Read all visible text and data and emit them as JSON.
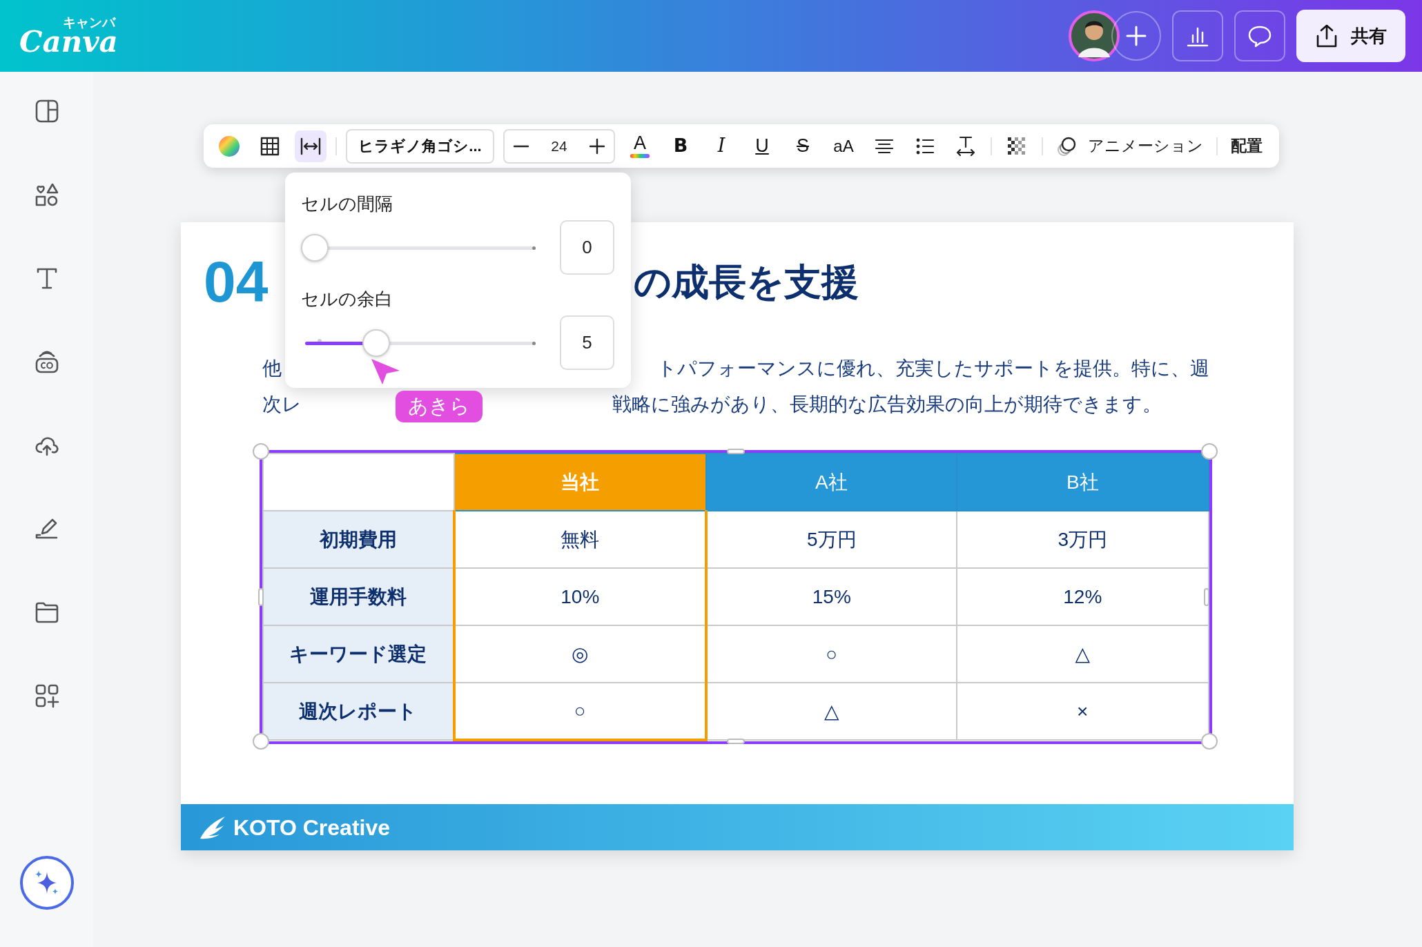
{
  "header": {
    "logo_kana": "キャンバ",
    "logo": "Canva",
    "share_label": "共有"
  },
  "toolbar": {
    "tools": [
      {
        "kind": "color",
        "selected": false
      },
      {
        "kind": "table",
        "selected": false
      },
      {
        "kind": "spacing",
        "selected": true
      }
    ],
    "font": "ヒラギノ角ゴシ...",
    "font_size": "24",
    "format": [
      {
        "kind": "text-color",
        "label": "A"
      },
      {
        "kind": "bold",
        "label": "B"
      },
      {
        "kind": "italic",
        "label": "I"
      },
      {
        "kind": "underline",
        "label": "U"
      },
      {
        "kind": "strike",
        "label": "S"
      },
      {
        "kind": "case",
        "label": "aA"
      }
    ],
    "animation": "アニメーション",
    "arrange": "配置"
  },
  "popup": {
    "sliders": [
      {
        "label": "セルの間隔",
        "level": 0,
        "value": "0"
      },
      {
        "label": "セルの余白",
        "level": 0.27,
        "value": "5"
      }
    ]
  },
  "cursor": {
    "name": "あきら"
  },
  "slide": {
    "number": "04",
    "title": "の成長を支援",
    "paragraph_lines": [
      {
        "left": "他",
        "right": "トパフォーマンスに優れ、充実したサポートを提供。特に、週"
      },
      {
        "left": "次レ",
        "right": "戦略に強みがあり、長期的な広告効果の向上が期待できます。"
      }
    ],
    "table": {
      "columns": [
        {
          "label": "当社",
          "highlighted": true
        },
        {
          "label": "A社",
          "highlighted": false
        },
        {
          "label": "B社",
          "highlighted": false
        }
      ],
      "rows": [
        {
          "label": "初期費用",
          "cells": [
            "無料",
            "5万円",
            "3万円"
          ]
        },
        {
          "label": "運用手数料",
          "cells": [
            "10%",
            "15%",
            "12%"
          ]
        },
        {
          "label": "キーワード選定",
          "cells": [
            "◎",
            "○",
            "△"
          ]
        },
        {
          "label": "週次レポート",
          "cells": [
            "○",
            "△",
            "×"
          ]
        }
      ]
    },
    "footer": {
      "brand": "KOTO Creative"
    }
  }
}
